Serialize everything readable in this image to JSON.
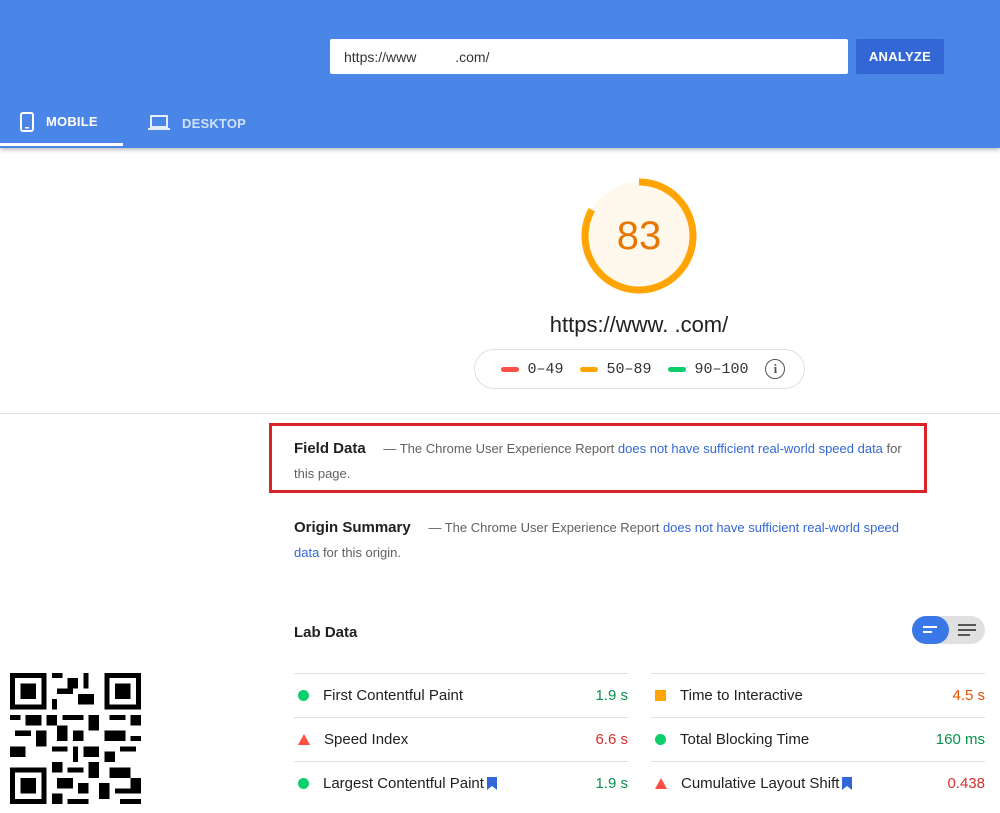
{
  "header": {
    "url_value": "https://www          .com/",
    "analyze_label": "ANALYZE",
    "tabs": [
      {
        "label": "MOBILE",
        "icon": "phone-icon",
        "active": true
      },
      {
        "label": "DESKTOP",
        "icon": "laptop-icon",
        "active": false
      }
    ]
  },
  "score": {
    "value": "83",
    "fraction": 0.83,
    "url": "https://www.          .com/",
    "color": "#ffa400"
  },
  "legend": [
    {
      "range": "0–49",
      "color": "#ff4e42"
    },
    {
      "range": "50–89",
      "color": "#ffa400"
    },
    {
      "range": "90–100",
      "color": "#0cce6b"
    }
  ],
  "field_data": {
    "title": "Field Data",
    "dash": "—",
    "text_before": "The Chrome User Experience Report",
    "link": "does not have sufficient real-world speed data",
    "text_after": "for this page."
  },
  "origin_summary": {
    "title": "Origin Summary",
    "dash": "—",
    "text_before": "The Chrome User Experience Report",
    "link": "does not have sufficient real-world speed data",
    "text_after": "for this origin."
  },
  "lab_data": {
    "title": "Lab Data",
    "metrics": [
      {
        "label": "First Contentful Paint",
        "value": "1.9 s",
        "status": "good",
        "color": "#0a8f4a",
        "flag": false
      },
      {
        "label": "Time to Interactive",
        "value": "4.5 s",
        "status": "average",
        "color": "#e65100",
        "flag": false
      },
      {
        "label": "Speed Index",
        "value": "6.6 s",
        "status": "poor",
        "color": "#d32f2f",
        "flag": false
      },
      {
        "label": "Total Blocking Time",
        "value": "160 ms",
        "status": "good",
        "color": "#0a8f4a",
        "flag": false
      },
      {
        "label": "Largest Contentful Paint",
        "value": "1.9 s",
        "status": "good",
        "color": "#0a8f4a",
        "flag": true
      },
      {
        "label": "Cumulative Layout Shift",
        "value": "0.438",
        "status": "poor",
        "color": "#d32f2f",
        "flag": true
      }
    ]
  }
}
